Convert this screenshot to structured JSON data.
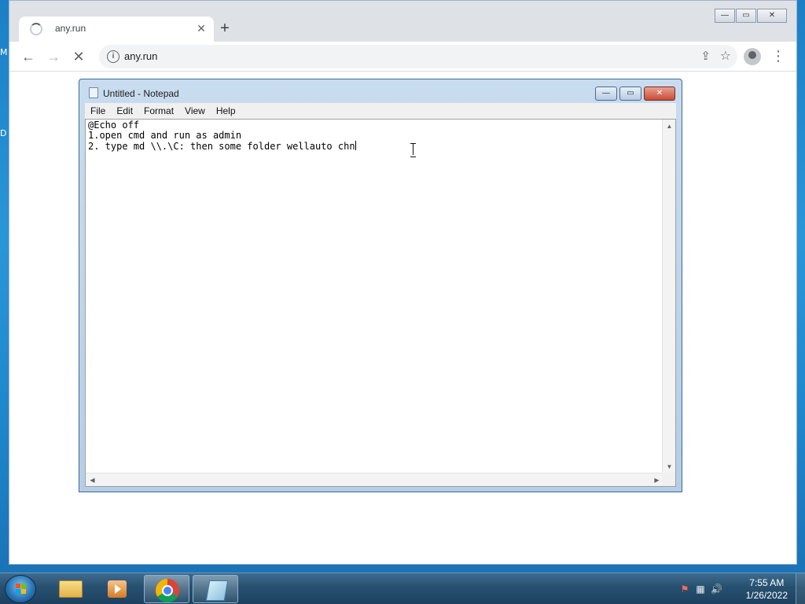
{
  "desktop": {
    "frag_top": "M",
    "frag_mid": "D"
  },
  "browser": {
    "tab_title": "any.run",
    "tab_close_glyph": "✕",
    "new_tab_glyph": "+",
    "url": "any.run",
    "back_glyph": "←",
    "forward_glyph": "→",
    "stop_glyph": "✕",
    "info_glyph": "i",
    "share_glyph": "⇪",
    "star_glyph": "☆",
    "menu_glyph": "⋮",
    "window_controls": {
      "minimize": "—",
      "maximize": "▭",
      "close": "✕"
    }
  },
  "notepad": {
    "title": "Untitled - Notepad",
    "controls": {
      "minimize": "—",
      "maximize": "▭",
      "close": "✕"
    },
    "menu": [
      "File",
      "Edit",
      "Format",
      "View",
      "Help"
    ],
    "lines": [
      "@Echo off",
      "1.open cmd and run as admin",
      "2. type md \\\\.\\C: then some folder wellauto chn"
    ],
    "scroll_up": "▲",
    "scroll_down": "▼",
    "scroll_left": "◀",
    "scroll_right": "▶"
  },
  "taskbar": {
    "items": [
      "folder-icon",
      "media-player-icon",
      "chrome-icon",
      "notepad-icon"
    ],
    "tray_flag": "⚑",
    "tray_network": "▦",
    "tray_volume": "🔊",
    "clock_time": "7:55 AM",
    "clock_date": "1/26/2022"
  }
}
